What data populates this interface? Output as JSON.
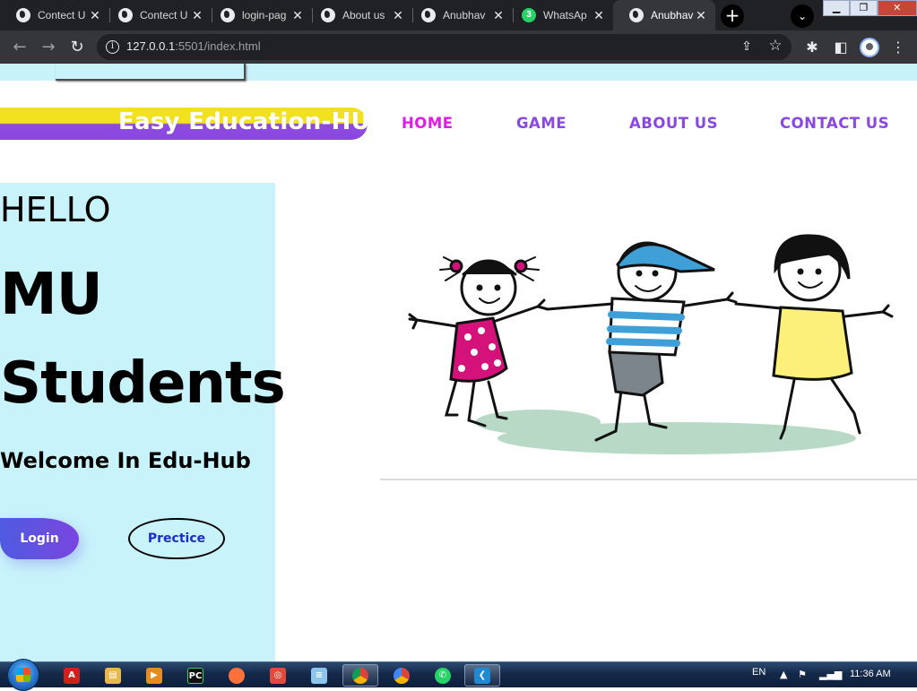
{
  "browser": {
    "tabs": [
      {
        "title": "Contect U",
        "icon": "globe-icon",
        "active": false
      },
      {
        "title": "Contect U",
        "icon": "globe-icon",
        "active": false
      },
      {
        "title": "login-pag",
        "icon": "globe-icon",
        "active": false
      },
      {
        "title": "About us",
        "icon": "globe-icon",
        "active": false
      },
      {
        "title": "Anubhav",
        "icon": "globe-icon",
        "active": false
      },
      {
        "title": "WhatsAp",
        "icon": "whatsapp-icon",
        "badge": "3",
        "active": false
      },
      {
        "title": "Anubhav",
        "icon": "globe-icon",
        "active": true
      }
    ],
    "tab_close_glyph": "✕",
    "new_tab_glyph": "+",
    "tab_search_glyph": "⌄",
    "window_controls": {
      "minimize": "▁",
      "maximize": "❐",
      "close": "✕"
    },
    "nav": {
      "back": "←",
      "forward": "→",
      "reload": "↻"
    },
    "url": {
      "host": "127.0.0.1",
      "rest": ":5501/index.html"
    },
    "toolbar_icons": [
      "share-icon",
      "star-icon",
      "extensions-icon",
      "sidepanel-icon",
      "profile-icon",
      "menu-icon"
    ]
  },
  "site": {
    "logo": "Easy Education-HUB",
    "nav": [
      {
        "label": "HOME",
        "active": true
      },
      {
        "label": "GAME",
        "active": false
      },
      {
        "label": "ABOUT US",
        "active": false
      },
      {
        "label": "CONTACT US",
        "active": false
      }
    ],
    "hero": {
      "hello": "HELLO",
      "line1": "MU",
      "line2": "Students",
      "welcome": "Welcome In Edu-Hub",
      "login_label": "Login",
      "practice_label": "Prectice"
    },
    "image_alt": "children-playing-illustration"
  },
  "colors": {
    "accent_purple": "#8a48e0",
    "nav_active": "#e21ae8",
    "panel_bg": "#c8f3fb",
    "logo_yellow": "#f2e11f"
  },
  "taskbar": {
    "apps": [
      "pdf-icon",
      "explorer-icon",
      "media-player-icon",
      "pycharm-icon",
      "firefox-icon",
      "screen-capture-icon",
      "notepad-icon",
      "chrome-icon",
      "chrome-alt-icon",
      "whatsapp-icon",
      "vscode-icon"
    ],
    "language": "EN",
    "time": "11:36 AM"
  }
}
